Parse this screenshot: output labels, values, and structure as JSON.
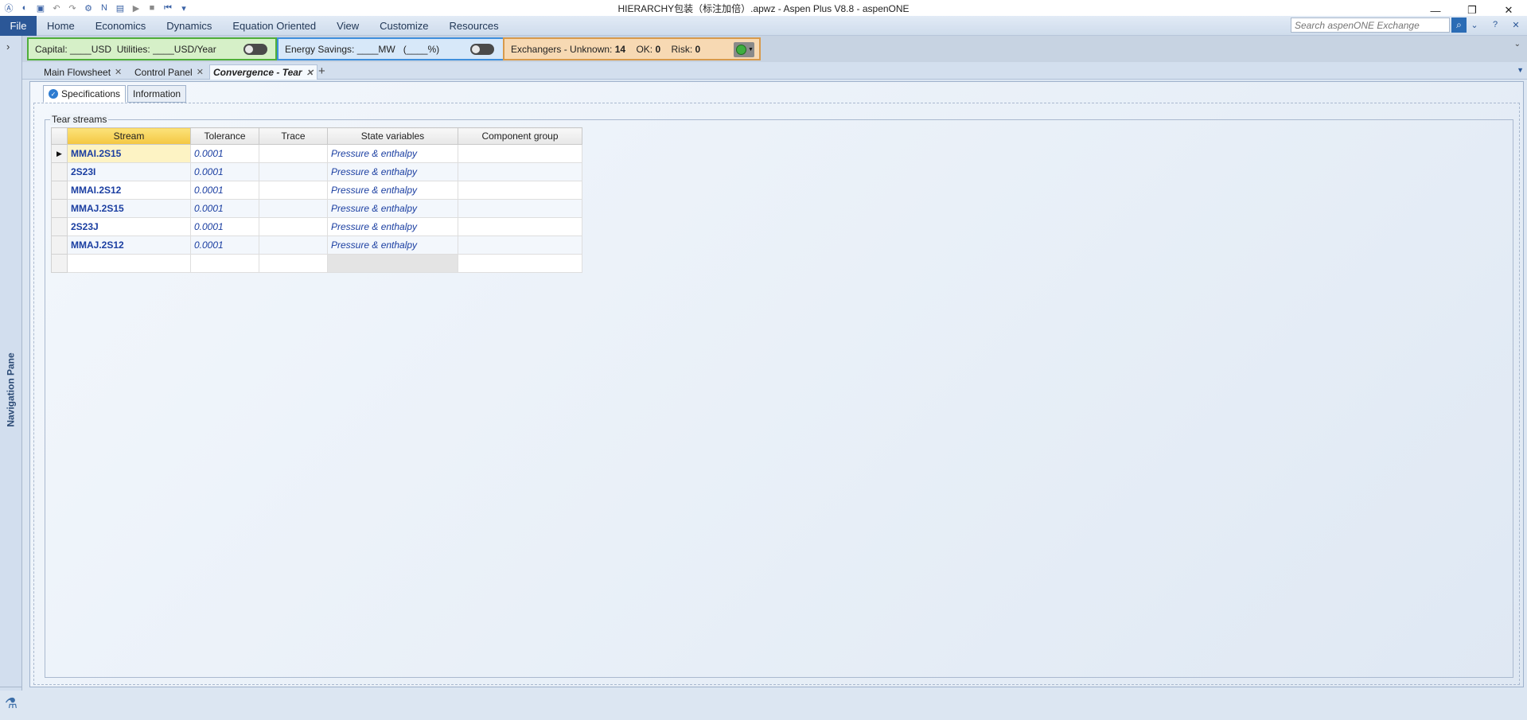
{
  "window": {
    "title": "HIERARCHY包装（标注加倍）.apwz - Aspen Plus V8.8 - aspenONE",
    "controls": {
      "minimize": "—",
      "restore": "❐",
      "close": "✕"
    }
  },
  "qat_icons": [
    "aspen-logo-icon",
    "open-icon",
    "save-icon",
    "undo-icon",
    "redo-icon",
    "settings-icon",
    "next-icon",
    "report-icon",
    "run-icon",
    "stop-icon",
    "reset-icon",
    "customize-qat-icon"
  ],
  "menu": {
    "file": "File",
    "items": [
      "Home",
      "Economics",
      "Dynamics",
      "Equation Oriented",
      "View",
      "Customize",
      "Resources"
    ],
    "search_placeholder": "Search aspenONE Exchange"
  },
  "nav": {
    "label": "Navigation Pane",
    "expand_glyph": "›"
  },
  "activation": {
    "capital_label": "Capital:",
    "capital_value": "____USD",
    "utilities_label": "Utilities:",
    "utilities_value": "____USD/Year",
    "energy_label": "Energy Savings:",
    "energy_value": "____MW",
    "energy_pct": "(____%)",
    "exch_label": "Exchangers - Unknown:",
    "exch_unknown": "14",
    "ok_label": "OK:",
    "ok_value": "0",
    "risk_label": "Risk:",
    "risk_value": "0"
  },
  "doc_tabs": [
    {
      "label": "Main Flowsheet",
      "active": false
    },
    {
      "label": "Control Panel",
      "active": false
    },
    {
      "label": "Convergence - Tear",
      "active": true
    }
  ],
  "form_tabs": [
    "Specifications",
    "Information"
  ],
  "group_label": "Tear streams",
  "table": {
    "columns": [
      "Stream",
      "Tolerance",
      "Trace",
      "State variables",
      "Component group"
    ],
    "rows": [
      {
        "stream": "MMAI.2S15",
        "tolerance": "0.0001",
        "trace": "",
        "state": "Pressure & enthalpy",
        "group": ""
      },
      {
        "stream": "2S23I",
        "tolerance": "0.0001",
        "trace": "",
        "state": "Pressure & enthalpy",
        "group": ""
      },
      {
        "stream": "MMAI.2S12",
        "tolerance": "0.0001",
        "trace": "",
        "state": "Pressure & enthalpy",
        "group": ""
      },
      {
        "stream": "MMAJ.2S15",
        "tolerance": "0.0001",
        "trace": "",
        "state": "Pressure & enthalpy",
        "group": ""
      },
      {
        "stream": "2S23J",
        "tolerance": "0.0001",
        "trace": "",
        "state": "Pressure & enthalpy",
        "group": ""
      },
      {
        "stream": "MMAJ.2S12",
        "tolerance": "0.0001",
        "trace": "",
        "state": "Pressure & enthalpy",
        "group": ""
      }
    ]
  },
  "colors": {
    "file_menu": "#2b5797",
    "capital_panel": "#d6f0c8",
    "energy_panel": "#d7e8f9",
    "exchangers_panel": "#f7d9b3",
    "selected_header": "#f4c742",
    "stream_text": "#1a3ea1"
  }
}
